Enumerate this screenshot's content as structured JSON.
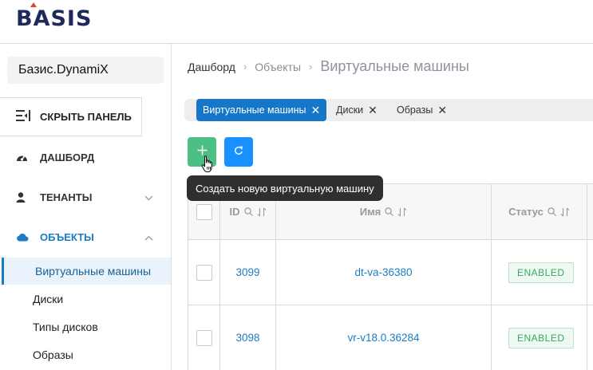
{
  "header": {
    "logo_text": "BASIS"
  },
  "sidebar": {
    "tenant": "Базис.DynamiX",
    "hide_panel": "СКРЫТЬ ПАНЕЛЬ",
    "nav": [
      {
        "label": "ДАШБОРД",
        "icon": "dashboard-icon"
      },
      {
        "label": "ТЕНАНТЫ",
        "icon": "user-icon"
      },
      {
        "label": "ОБЪЕКТЫ",
        "icon": "cloud-icon"
      }
    ],
    "sub_items": [
      "Виртуальные машины",
      "Диски",
      "Типы дисков",
      "Образы"
    ]
  },
  "breadcrumb": {
    "items": [
      "Дашборд",
      "Объекты"
    ],
    "current": "Виртуальные машины"
  },
  "tabs": [
    "Виртуальные машины",
    "Диски",
    "Образы"
  ],
  "toolbar": {
    "tooltip": "Создать новую виртуальную машину"
  },
  "table": {
    "columns": [
      "ID",
      "Имя",
      "Статус"
    ],
    "rows": [
      {
        "id": "3099",
        "name": "dt-va-36380",
        "status": "ENABLED"
      },
      {
        "id": "3098",
        "name": "vr-v18.0.36284",
        "status": "ENABLED"
      }
    ]
  },
  "colors": {
    "accent": "#1a7dc4",
    "add_button": "#4cbf85",
    "refresh_button": "#1890ff",
    "status_enabled": "#3aa863"
  }
}
